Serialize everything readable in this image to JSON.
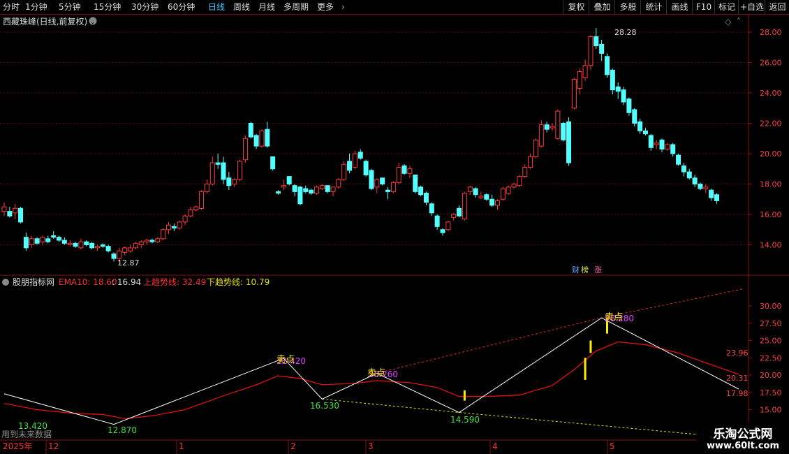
{
  "toolbar": {
    "periods": [
      "分时",
      "1分钟",
      "5分钟",
      "15分钟",
      "30分钟",
      "60分钟",
      "日线",
      "周线",
      "月线",
      "多周期",
      "更多"
    ],
    "active_period": "日线",
    "right_buttons": [
      "复权",
      "叠加",
      "多股",
      "统计",
      "画线",
      "F10",
      "标记",
      "+自选",
      "返回"
    ]
  },
  "main_panel": {
    "title": "西藏珠峰(日线,前复权)",
    "high_label": "28.28",
    "low_label": "12.87",
    "badges": {
      "cai": "财",
      "bang": "榜",
      "zhang": "涨"
    }
  },
  "indicator_panel": {
    "name": "股朋指标网",
    "ema_label": "EMA10: 18.60",
    "ema_extra": ": 16.94",
    "up_trend_label": "上趋势线: 32.49",
    "down_trend_label": "下趋势线: 10.79",
    "future_data_note": "用到未来数据",
    "annotations": [
      {
        "id": "sell1",
        "text": "卖点",
        "value": "22.420"
      },
      {
        "id": "sell2",
        "text": "卖点",
        "value": "20.260"
      },
      {
        "id": "sell3",
        "text": "卖点",
        "value": "28.280"
      },
      {
        "id": "low0",
        "value": "13.420"
      },
      {
        "id": "low1",
        "value": "12.870"
      },
      {
        "id": "low2",
        "value": "16.530"
      },
      {
        "id": "low3",
        "value": "14.590"
      }
    ],
    "right_values": {
      "v1": "23.96",
      "v2": "20.31",
      "v3": "17.98"
    }
  },
  "x_axis": {
    "year_label": "2025年",
    "months": [
      "12",
      "1",
      "2",
      "3",
      "4",
      "5"
    ]
  },
  "watermark": {
    "line1": "乐淘公式网",
    "line2": "www.60lt.com"
  },
  "chart_data": {
    "type": "candlestick",
    "title": "西藏珠峰(日线,前复权)",
    "price_axis": {
      "min": 12.5,
      "max": 28.5,
      "ticks": [
        14.0,
        16.0,
        18.0,
        20.0,
        22.0,
        24.0,
        26.0,
        28.0
      ]
    },
    "indicator_axis": {
      "ticks": [
        15.0,
        17.5,
        20.0,
        22.5,
        25.0,
        27.5,
        30.0
      ]
    },
    "colors": {
      "up": "#ff3b3b",
      "down": "#54ffff",
      "ema": "#e01010",
      "zigzag": "#ffffff",
      "up_trend": "#e03030",
      "down_trend": "#e6e000",
      "signal": "#ffee00"
    },
    "candles": [
      {
        "o": 16.2,
        "h": 16.8,
        "l": 15.9,
        "c": 16.5
      },
      {
        "o": 16.2,
        "h": 16.5,
        "l": 15.8,
        "c": 15.9
      },
      {
        "o": 16.1,
        "h": 16.7,
        "l": 15.7,
        "c": 16.4
      },
      {
        "o": 16.4,
        "h": 16.5,
        "l": 15.4,
        "c": 15.5
      },
      {
        "o": 14.5,
        "h": 14.8,
        "l": 13.6,
        "c": 13.8
      },
      {
        "o": 14.0,
        "h": 14.6,
        "l": 13.8,
        "c": 14.4
      },
      {
        "o": 14.4,
        "h": 14.5,
        "l": 14.0,
        "c": 14.1
      },
      {
        "o": 14.2,
        "h": 14.6,
        "l": 14.0,
        "c": 14.5
      },
      {
        "o": 14.4,
        "h": 14.6,
        "l": 14.1,
        "c": 14.2
      },
      {
        "o": 14.6,
        "h": 14.9,
        "l": 14.4,
        "c": 14.5
      },
      {
        "o": 14.5,
        "h": 14.6,
        "l": 14.2,
        "c": 14.3
      },
      {
        "o": 14.3,
        "h": 14.5,
        "l": 14.0,
        "c": 14.1
      },
      {
        "o": 14.0,
        "h": 14.3,
        "l": 13.9,
        "c": 14.1
      },
      {
        "o": 14.1,
        "h": 14.2,
        "l": 13.8,
        "c": 13.9
      },
      {
        "o": 13.8,
        "h": 14.4,
        "l": 13.7,
        "c": 14.2
      },
      {
        "o": 14.2,
        "h": 14.3,
        "l": 13.9,
        "c": 14.0
      },
      {
        "o": 14.1,
        "h": 14.2,
        "l": 13.7,
        "c": 13.8
      },
      {
        "o": 13.8,
        "h": 14.0,
        "l": 13.6,
        "c": 13.9
      },
      {
        "o": 14.0,
        "h": 14.1,
        "l": 13.8,
        "c": 13.9
      },
      {
        "o": 13.9,
        "h": 14.0,
        "l": 13.5,
        "c": 13.6
      },
      {
        "o": 13.4,
        "h": 13.5,
        "l": 12.9,
        "c": 13.1
      },
      {
        "o": 13.1,
        "h": 13.8,
        "l": 12.9,
        "c": 13.6
      },
      {
        "o": 13.5,
        "h": 13.9,
        "l": 13.3,
        "c": 13.8
      },
      {
        "o": 13.6,
        "h": 14.0,
        "l": 13.5,
        "c": 13.8
      },
      {
        "o": 13.8,
        "h": 14.2,
        "l": 13.7,
        "c": 14.1
      },
      {
        "o": 14.0,
        "h": 14.3,
        "l": 13.8,
        "c": 14.2
      },
      {
        "o": 14.2,
        "h": 14.4,
        "l": 14.0,
        "c": 14.3
      },
      {
        "o": 14.3,
        "h": 14.4,
        "l": 14.1,
        "c": 14.2
      },
      {
        "o": 14.2,
        "h": 14.5,
        "l": 14.1,
        "c": 14.4
      },
      {
        "o": 14.4,
        "h": 15.1,
        "l": 14.3,
        "c": 15.0
      },
      {
        "o": 15.0,
        "h": 15.5,
        "l": 14.7,
        "c": 15.3
      },
      {
        "o": 15.2,
        "h": 15.4,
        "l": 14.9,
        "c": 15.1
      },
      {
        "o": 15.1,
        "h": 15.6,
        "l": 15.0,
        "c": 15.5
      },
      {
        "o": 15.5,
        "h": 16.0,
        "l": 15.3,
        "c": 15.9
      },
      {
        "o": 15.9,
        "h": 16.5,
        "l": 15.8,
        "c": 16.3
      },
      {
        "o": 16.3,
        "h": 16.6,
        "l": 16.2,
        "c": 16.5
      },
      {
        "o": 16.4,
        "h": 17.6,
        "l": 16.3,
        "c": 17.5
      },
      {
        "o": 17.5,
        "h": 18.3,
        "l": 17.4,
        "c": 18.0
      },
      {
        "o": 18.0,
        "h": 19.8,
        "l": 17.9,
        "c": 19.4
      },
      {
        "o": 19.4,
        "h": 20.0,
        "l": 19.0,
        "c": 19.3
      },
      {
        "o": 19.4,
        "h": 19.8,
        "l": 18.0,
        "c": 18.3
      },
      {
        "o": 18.4,
        "h": 18.8,
        "l": 17.6,
        "c": 17.9
      },
      {
        "o": 18.0,
        "h": 18.4,
        "l": 17.8,
        "c": 18.3
      },
      {
        "o": 18.3,
        "h": 19.6,
        "l": 18.2,
        "c": 19.5
      },
      {
        "o": 19.6,
        "h": 21.2,
        "l": 19.4,
        "c": 21.0
      },
      {
        "o": 22.0,
        "h": 22.1,
        "l": 21.0,
        "c": 21.1
      },
      {
        "o": 21.2,
        "h": 21.3,
        "l": 20.3,
        "c": 20.5
      },
      {
        "o": 20.5,
        "h": 21.6,
        "l": 20.4,
        "c": 21.5
      },
      {
        "o": 21.6,
        "h": 22.1,
        "l": 20.4,
        "c": 20.5
      },
      {
        "o": 19.8,
        "h": 19.8,
        "l": 18.9,
        "c": 19.0
      },
      {
        "o": 17.5,
        "h": 17.6,
        "l": 17.3,
        "c": 17.4
      },
      {
        "o": 17.8,
        "h": 18.3,
        "l": 17.6,
        "c": 17.9
      },
      {
        "o": 18.5,
        "h": 18.5,
        "l": 17.9,
        "c": 18.0
      },
      {
        "o": 17.9,
        "h": 18.0,
        "l": 17.2,
        "c": 17.5
      },
      {
        "o": 17.8,
        "h": 17.9,
        "l": 16.6,
        "c": 16.7
      },
      {
        "o": 17.7,
        "h": 17.9,
        "l": 17.4,
        "c": 17.5
      },
      {
        "o": 17.6,
        "h": 17.7,
        "l": 17.3,
        "c": 17.4
      },
      {
        "o": 17.4,
        "h": 17.9,
        "l": 17.3,
        "c": 17.8
      },
      {
        "o": 17.7,
        "h": 18.0,
        "l": 17.6,
        "c": 17.9
      },
      {
        "o": 17.9,
        "h": 17.9,
        "l": 17.4,
        "c": 17.5
      },
      {
        "o": 17.5,
        "h": 17.8,
        "l": 17.2,
        "c": 17.8
      },
      {
        "o": 17.8,
        "h": 18.4,
        "l": 17.7,
        "c": 18.3
      },
      {
        "o": 18.3,
        "h": 19.5,
        "l": 18.2,
        "c": 19.3
      },
      {
        "o": 19.5,
        "h": 20.0,
        "l": 18.7,
        "c": 18.9
      },
      {
        "o": 19.1,
        "h": 20.2,
        "l": 19.0,
        "c": 20.0
      },
      {
        "o": 20.1,
        "h": 20.3,
        "l": 19.6,
        "c": 19.7
      },
      {
        "o": 19.5,
        "h": 19.6,
        "l": 18.5,
        "c": 18.6
      },
      {
        "o": 18.9,
        "h": 19.0,
        "l": 17.6,
        "c": 17.7
      },
      {
        "o": 17.8,
        "h": 18.4,
        "l": 17.4,
        "c": 18.3
      },
      {
        "o": 18.4,
        "h": 18.4,
        "l": 17.9,
        "c": 18.0
      },
      {
        "o": 17.6,
        "h": 17.8,
        "l": 17.0,
        "c": 17.5
      },
      {
        "o": 17.5,
        "h": 18.2,
        "l": 17.4,
        "c": 18.1
      },
      {
        "o": 18.1,
        "h": 19.4,
        "l": 18.0,
        "c": 19.1
      },
      {
        "o": 19.2,
        "h": 19.3,
        "l": 18.6,
        "c": 18.7
      },
      {
        "o": 18.7,
        "h": 19.2,
        "l": 18.4,
        "c": 19.0
      },
      {
        "o": 18.6,
        "h": 18.6,
        "l": 17.4,
        "c": 17.5
      },
      {
        "o": 17.8,
        "h": 17.9,
        "l": 17.2,
        "c": 17.3
      },
      {
        "o": 17.4,
        "h": 17.5,
        "l": 16.6,
        "c": 16.8
      },
      {
        "o": 16.7,
        "h": 16.8,
        "l": 15.9,
        "c": 16.1
      },
      {
        "o": 15.9,
        "h": 16.0,
        "l": 15.0,
        "c": 15.2
      },
      {
        "o": 15.0,
        "h": 15.1,
        "l": 14.6,
        "c": 14.8
      },
      {
        "o": 15.0,
        "h": 15.6,
        "l": 14.9,
        "c": 15.5
      },
      {
        "o": 15.8,
        "h": 16.1,
        "l": 15.6,
        "c": 16.0
      },
      {
        "o": 16.4,
        "h": 16.6,
        "l": 15.8,
        "c": 15.9
      },
      {
        "o": 15.7,
        "h": 17.5,
        "l": 15.6,
        "c": 17.4
      },
      {
        "o": 17.5,
        "h": 17.9,
        "l": 17.3,
        "c": 17.8
      },
      {
        "o": 17.7,
        "h": 17.8,
        "l": 17.1,
        "c": 17.3
      },
      {
        "o": 17.1,
        "h": 17.5,
        "l": 17.0,
        "c": 17.2
      },
      {
        "o": 17.3,
        "h": 17.4,
        "l": 16.9,
        "c": 17.0
      },
      {
        "o": 17.0,
        "h": 17.3,
        "l": 16.5,
        "c": 16.6
      },
      {
        "o": 16.6,
        "h": 17.0,
        "l": 16.3,
        "c": 16.9
      },
      {
        "o": 17.0,
        "h": 17.8,
        "l": 16.9,
        "c": 17.7
      },
      {
        "o": 17.4,
        "h": 17.9,
        "l": 17.3,
        "c": 17.8
      },
      {
        "o": 17.8,
        "h": 18.1,
        "l": 17.7,
        "c": 18.0
      },
      {
        "o": 17.9,
        "h": 18.6,
        "l": 17.8,
        "c": 18.5
      },
      {
        "o": 18.5,
        "h": 19.3,
        "l": 18.4,
        "c": 19.1
      },
      {
        "o": 19.1,
        "h": 20.0,
        "l": 19.0,
        "c": 19.8
      },
      {
        "o": 19.8,
        "h": 21.0,
        "l": 19.7,
        "c": 20.9
      },
      {
        "o": 20.5,
        "h": 22.2,
        "l": 20.4,
        "c": 21.9
      },
      {
        "o": 21.9,
        "h": 22.1,
        "l": 21.4,
        "c": 21.6
      },
      {
        "o": 21.7,
        "h": 22.0,
        "l": 21.5,
        "c": 21.8
      },
      {
        "o": 21.0,
        "h": 22.9,
        "l": 20.9,
        "c": 22.8
      },
      {
        "o": 22.0,
        "h": 22.1,
        "l": 20.8,
        "c": 20.9
      },
      {
        "o": 22.1,
        "h": 22.4,
        "l": 19.2,
        "c": 19.4
      },
      {
        "o": 23.0,
        "h": 25.0,
        "l": 22.9,
        "c": 24.9
      },
      {
        "o": 24.3,
        "h": 25.6,
        "l": 23.9,
        "c": 25.4
      },
      {
        "o": 25.0,
        "h": 26.2,
        "l": 24.8,
        "c": 25.8
      },
      {
        "o": 25.8,
        "h": 27.8,
        "l": 25.5,
        "c": 27.7
      },
      {
        "o": 27.7,
        "h": 28.28,
        "l": 26.9,
        "c": 27.1
      },
      {
        "o": 27.2,
        "h": 27.5,
        "l": 26.1,
        "c": 26.6
      },
      {
        "o": 26.4,
        "h": 26.6,
        "l": 25.0,
        "c": 25.2
      },
      {
        "o": 25.5,
        "h": 25.6,
        "l": 23.9,
        "c": 24.2
      },
      {
        "o": 24.4,
        "h": 24.7,
        "l": 23.6,
        "c": 24.1
      },
      {
        "o": 24.2,
        "h": 24.4,
        "l": 23.2,
        "c": 23.4
      },
      {
        "o": 23.6,
        "h": 23.7,
        "l": 22.5,
        "c": 22.7
      },
      {
        "o": 22.9,
        "h": 23.0,
        "l": 21.8,
        "c": 22.0
      },
      {
        "o": 22.1,
        "h": 22.3,
        "l": 21.3,
        "c": 21.5
      },
      {
        "o": 21.5,
        "h": 21.7,
        "l": 21.2,
        "c": 21.3
      },
      {
        "o": 21.2,
        "h": 21.3,
        "l": 20.2,
        "c": 20.4
      },
      {
        "o": 20.6,
        "h": 20.9,
        "l": 20.3,
        "c": 20.7
      },
      {
        "o": 20.9,
        "h": 21.0,
        "l": 20.1,
        "c": 20.3
      },
      {
        "o": 20.3,
        "h": 20.7,
        "l": 20.2,
        "c": 20.6
      },
      {
        "o": 20.6,
        "h": 20.7,
        "l": 19.8,
        "c": 20.0
      },
      {
        "o": 19.9,
        "h": 20.0,
        "l": 19.2,
        "c": 19.3
      },
      {
        "o": 19.2,
        "h": 19.4,
        "l": 18.5,
        "c": 18.8
      },
      {
        "o": 18.8,
        "h": 19.0,
        "l": 18.3,
        "c": 18.4
      },
      {
        "o": 18.4,
        "h": 18.6,
        "l": 17.8,
        "c": 18.0
      },
      {
        "o": 18.0,
        "h": 18.1,
        "l": 17.6,
        "c": 17.7
      },
      {
        "o": 17.7,
        "h": 18.0,
        "l": 17.4,
        "c": 17.8
      },
      {
        "o": 17.6,
        "h": 17.7,
        "l": 16.9,
        "c": 17.1
      },
      {
        "o": 17.3,
        "h": 17.4,
        "l": 16.7,
        "c": 16.9
      }
    ],
    "zigzag": [
      [
        0,
        17.3
      ],
      [
        20,
        12.87
      ],
      [
        51,
        22.42
      ],
      [
        58,
        16.53
      ],
      [
        68,
        20.26
      ],
      [
        83,
        14.59
      ],
      [
        109,
        28.28
      ],
      [
        134,
        17.98
      ]
    ],
    "ema": [
      [
        0,
        15.9
      ],
      [
        6,
        15.0
      ],
      [
        12,
        14.5
      ],
      [
        18,
        14.3
      ],
      [
        22,
        13.7
      ],
      [
        27,
        14.1
      ],
      [
        33,
        15.0
      ],
      [
        40,
        17.0
      ],
      [
        46,
        18.6
      ],
      [
        50,
        19.9
      ],
      [
        54,
        19.5
      ],
      [
        58,
        18.6
      ],
      [
        64,
        18.8
      ],
      [
        68,
        19.2
      ],
      [
        74,
        18.9
      ],
      [
        79,
        18.2
      ],
      [
        83,
        16.9
      ],
      [
        88,
        16.9
      ],
      [
        94,
        17.1
      ],
      [
        100,
        18.5
      ],
      [
        104,
        20.8
      ],
      [
        108,
        23.5
      ],
      [
        112,
        24.8
      ],
      [
        117,
        24.4
      ],
      [
        123,
        23.2
      ],
      [
        129,
        21.5
      ],
      [
        134,
        20.1
      ]
    ],
    "up_trend": [
      [
        68,
        20.26
      ],
      [
        109,
        28.28
      ],
      [
        135,
        32.49
      ]
    ],
    "down_trend": [
      [
        58,
        16.53
      ],
      [
        83,
        14.59
      ],
      [
        135,
        10.79
      ]
    ],
    "signals": [
      [
        84,
        16.3,
        17.8
      ],
      [
        106,
        19.3,
        22.5
      ],
      [
        107,
        23.2,
        25.0
      ],
      [
        110,
        26.0,
        28.3
      ]
    ]
  }
}
